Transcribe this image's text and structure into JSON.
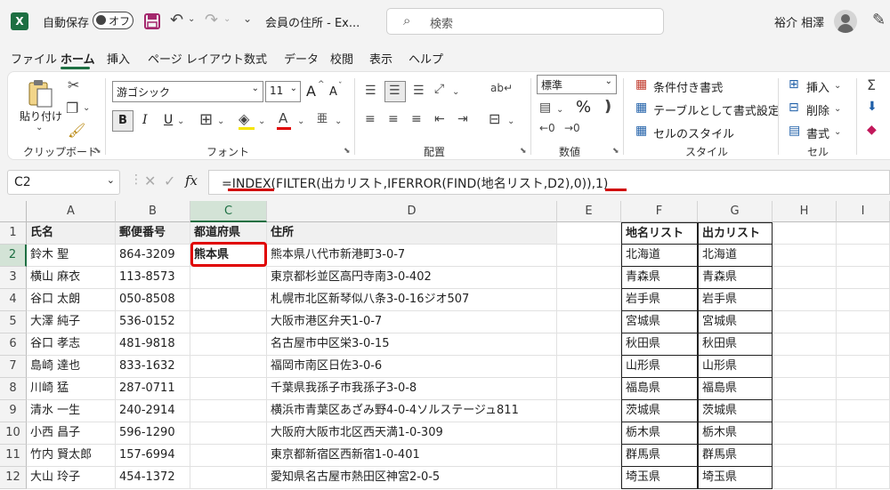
{
  "titlebar": {
    "logo": "X",
    "autosave_label": "自動保存",
    "autosave_state": "オフ",
    "doc_title": "会員の住所 - Ex...",
    "search_placeholder": "検索",
    "user_name": "裕介 相澤"
  },
  "tabs": [
    "ファイル",
    "ホーム",
    "挿入",
    "ページ レイアウト",
    "数式",
    "データ",
    "校閲",
    "表示",
    "ヘルプ"
  ],
  "active_tab": "ホーム",
  "ribbon": {
    "clipboard": {
      "paste": "貼り付け",
      "label": "クリップボード"
    },
    "font": {
      "name": "游ゴシック",
      "size": "11",
      "grow": "A",
      "shrink": "A",
      "bold": "B",
      "italic": "I",
      "underline": "U",
      "label": "フォント"
    },
    "alignment": {
      "label": "配置"
    },
    "number": {
      "format": "標準",
      "percent": "%",
      "label": "数値"
    },
    "styles": {
      "conditional": "条件付き書式",
      "table": "テーブルとして書式設定",
      "cell": "セルのスタイル",
      "label": "スタイル"
    },
    "cells": {
      "insert": "挿入",
      "delete": "削除",
      "format": "書式",
      "label": "セル"
    }
  },
  "formula_bar": {
    "name_box": "C2",
    "fx": "fx",
    "formula": "=INDEX(FILTER(出カリスト,IFERROR(FIND(地名リスト,D2),0)),1)"
  },
  "columns": [
    "A",
    "B",
    "C",
    "D",
    "E",
    "F",
    "G",
    "H",
    "I"
  ],
  "selected_column": "C",
  "rows": [
    {
      "n": "1",
      "name": "氏名",
      "zip": "郵便番号",
      "pref": "都道府県",
      "addr": "住所",
      "f": "地名リスト",
      "g": "出カリスト"
    },
    {
      "n": "2",
      "name": "鈴木 聖",
      "zip": "864-3209",
      "pref": "熊本県",
      "addr": "熊本県八代市新港町3-0-7",
      "f": "北海道",
      "g": "北海道"
    },
    {
      "n": "3",
      "name": "横山 麻衣",
      "zip": "113-8573",
      "pref": "",
      "addr": "東京都杉並区高円寺南3-0-402",
      "f": "青森県",
      "g": "青森県"
    },
    {
      "n": "4",
      "name": "谷口 太朗",
      "zip": "050-8508",
      "pref": "",
      "addr": "札幌市北区新琴似八条3-0-16ジオ507",
      "f": "岩手県",
      "g": "岩手県"
    },
    {
      "n": "5",
      "name": "大澤 純子",
      "zip": "536-0152",
      "pref": "",
      "addr": "大阪市港区弁天1-0-7",
      "f": "宮城県",
      "g": "宮城県"
    },
    {
      "n": "6",
      "name": "谷口 孝志",
      "zip": "481-9818",
      "pref": "",
      "addr": "名古屋市中区栄3-0-15",
      "f": "秋田県",
      "g": "秋田県"
    },
    {
      "n": "7",
      "name": "島崎 達也",
      "zip": "833-1632",
      "pref": "",
      "addr": "福岡市南区日佐3-0-6",
      "f": "山形県",
      "g": "山形県"
    },
    {
      "n": "8",
      "name": "川崎 猛",
      "zip": "287-0711",
      "pref": "",
      "addr": "千葉県我孫子市我孫子3-0-8",
      "f": "福島県",
      "g": "福島県"
    },
    {
      "n": "9",
      "name": "清水 一生",
      "zip": "240-2914",
      "pref": "",
      "addr": "横浜市青葉区あざみ野4-0-4ソルステージュ811",
      "f": "茨城県",
      "g": "茨城県"
    },
    {
      "n": "10",
      "name": "小西 昌子",
      "zip": "596-1290",
      "pref": "",
      "addr": "大阪府大阪市北区西天満1-0-309",
      "f": "栃木県",
      "g": "栃木県"
    },
    {
      "n": "11",
      "name": "竹内 賢太郎",
      "zip": "157-6994",
      "pref": "",
      "addr": "東京都新宿区西新宿1-0-401",
      "f": "群馬県",
      "g": "群馬県"
    },
    {
      "n": "12",
      "name": "大山 玲子",
      "zip": "454-1372",
      "pref": "",
      "addr": "愛知県名古屋市熱田区神宮2-0-5",
      "f": "埼玉県",
      "g": "埼玉県"
    }
  ],
  "colors": {
    "excel_green": "#1d6f42",
    "annotation_red": "#d00000"
  }
}
